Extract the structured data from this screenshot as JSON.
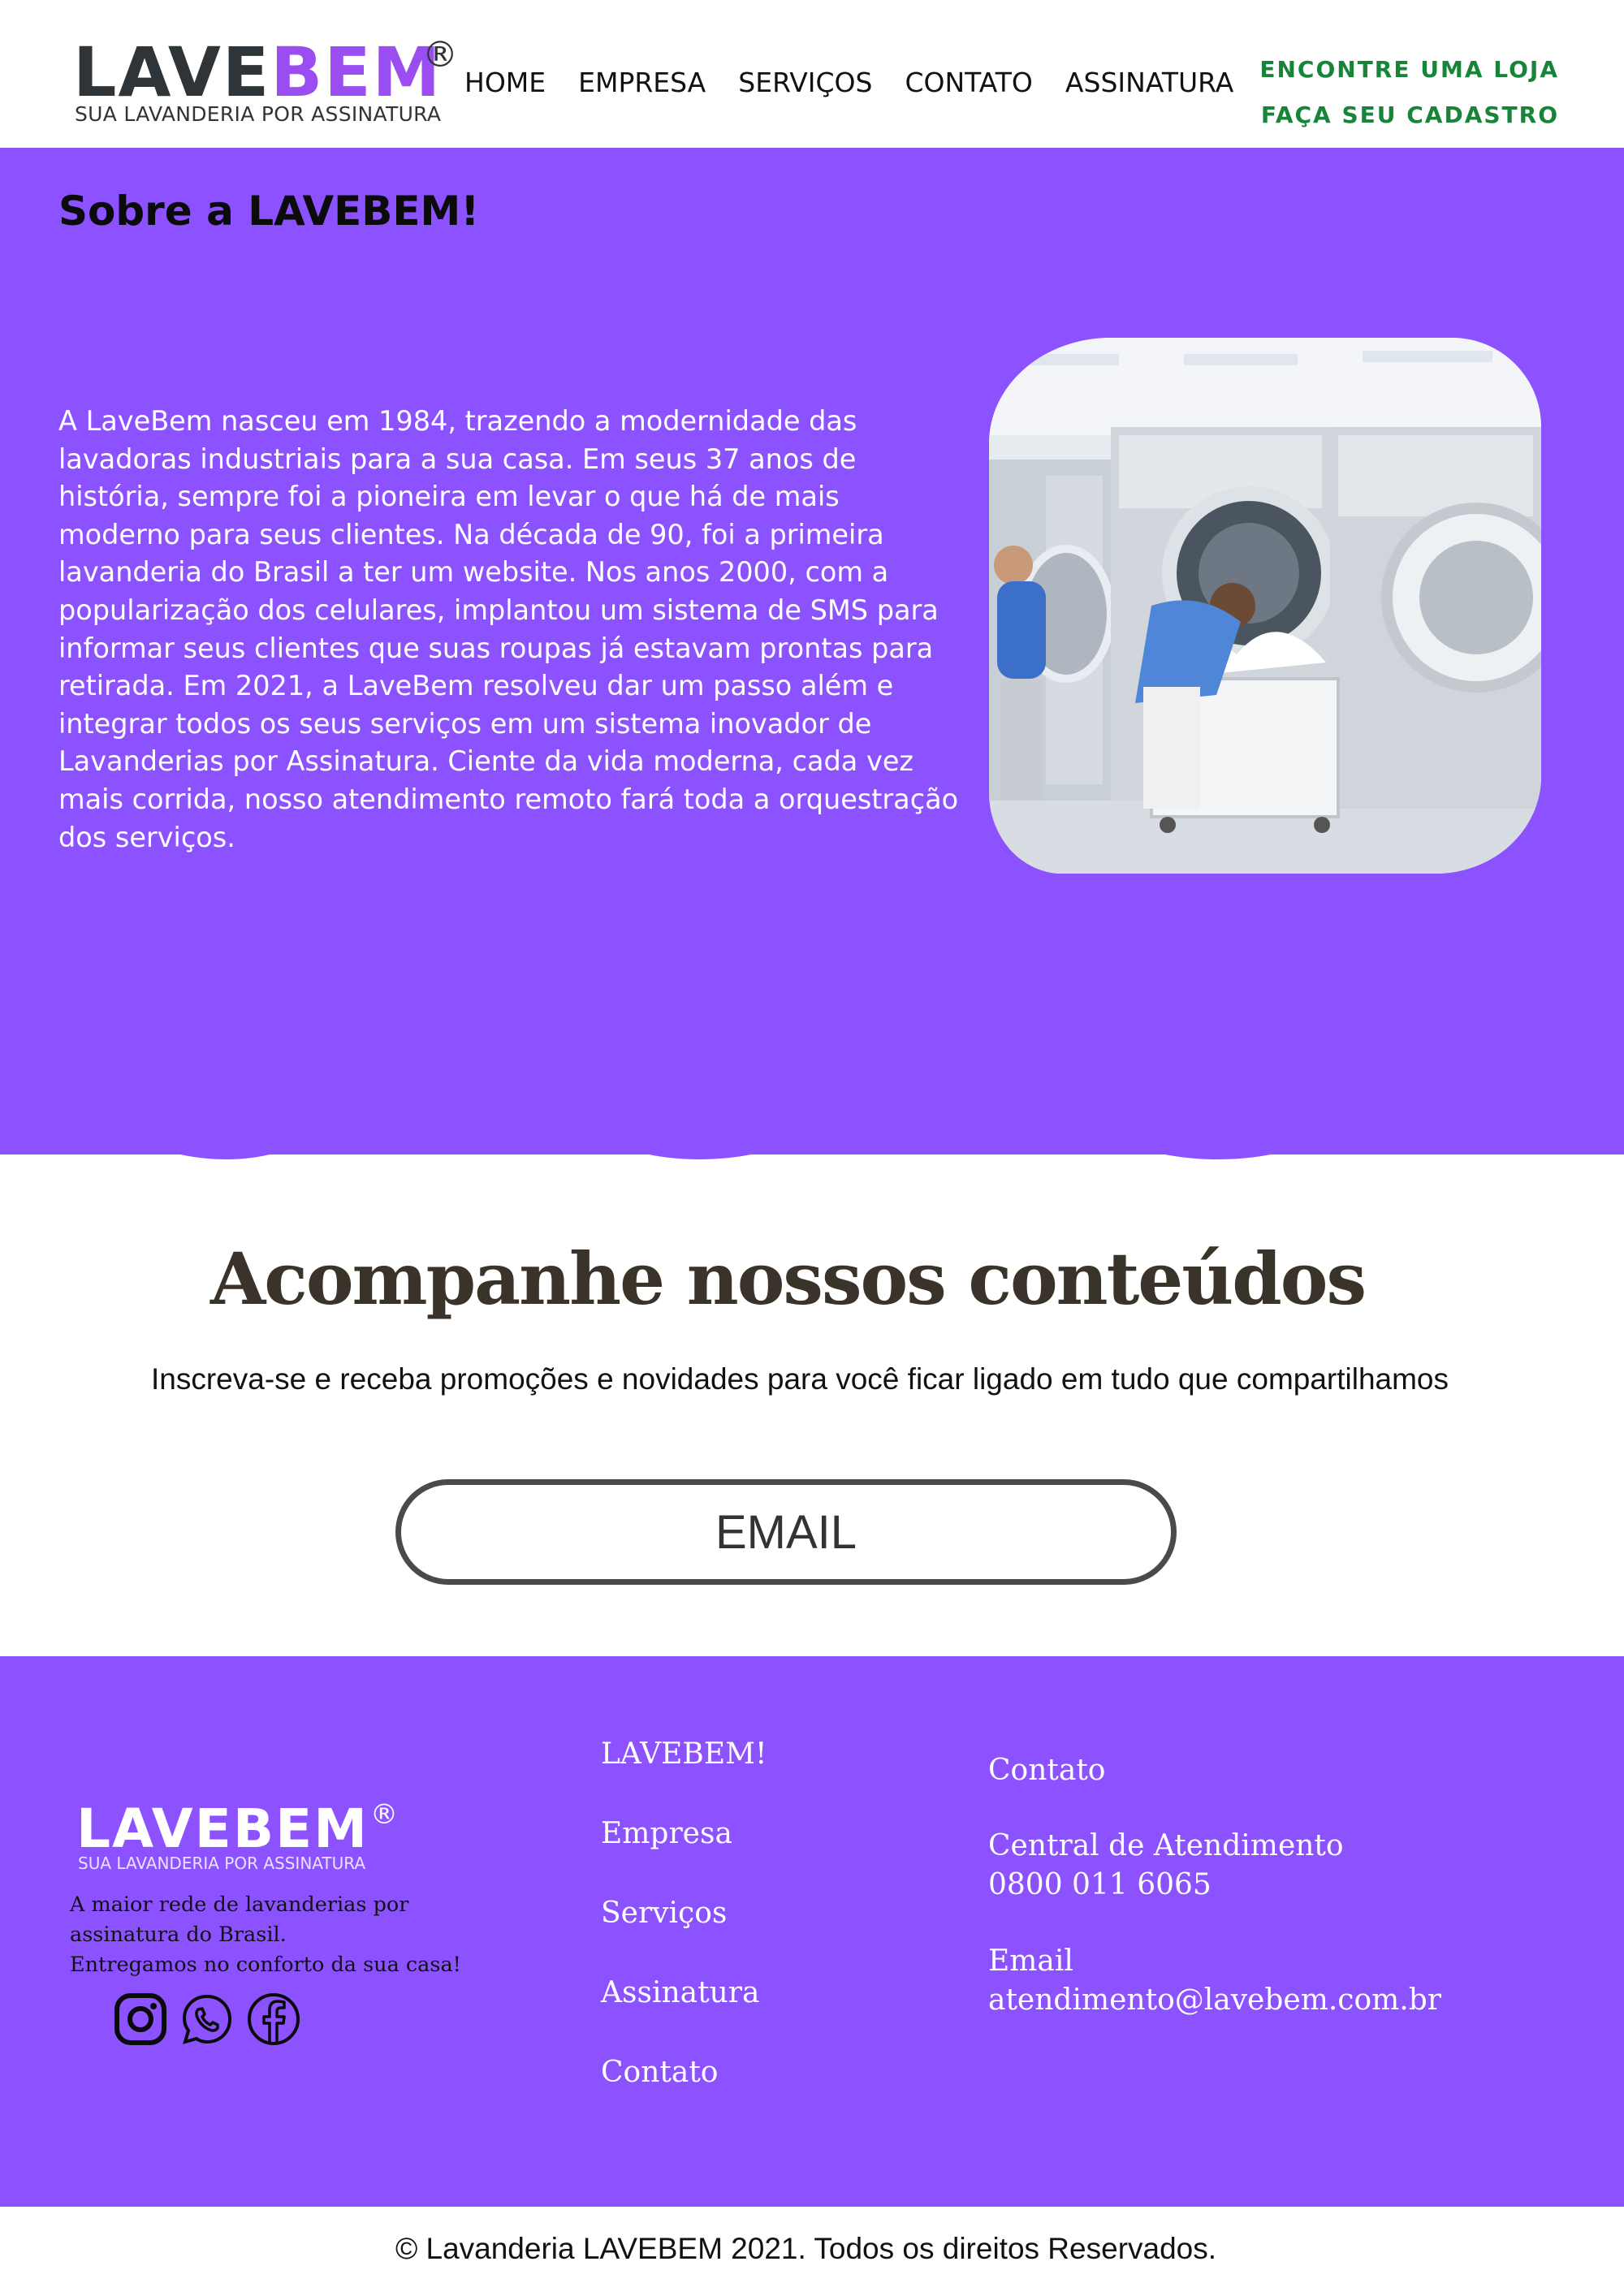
{
  "brand": {
    "name_part1": "LAVE",
    "name_part2": "BEM",
    "registered": "®",
    "tagline": "SUA LAVANDERIA POR ASSINATURA",
    "accent_color": "#8c52ff",
    "logo_purple": "#9a4df0",
    "cta_green": "#17843a"
  },
  "nav": {
    "items": [
      {
        "label": "HOME"
      },
      {
        "label": "EMPRESA"
      },
      {
        "label": "SERVIÇOS"
      },
      {
        "label": "CONTATO"
      },
      {
        "label": "ASSINATURA"
      }
    ]
  },
  "header_links": {
    "find_store": "ENCONTRE UMA LOJA",
    "register": "FAÇA SEU CADASTRO"
  },
  "about": {
    "title": "Sobre a LAVEBEM!",
    "text": "A LaveBem nasceu em 1984, trazendo a modernidade das lavadoras industriais para a sua casa. Em seus 37 anos de história, sempre foi a pioneira em levar o que há de mais moderno para seus clientes. Na década de 90, foi a primeira lavanderia do Brasil a ter um website. Nos anos 2000, com a popularização dos celulares, implantou um sistema de SMS para informar seus clientes que suas roupas já estavam prontas para retirada. Em 2021, a LaveBem resolveu dar um passo além e integrar todos os seus serviços em um sistema inovador de Lavanderias por Assinatura. Ciente da vida moderna, cada vez mais corrida, nosso atendimento remoto fará toda a orquestração dos serviços."
  },
  "newsletter": {
    "title": "Acompanhe nossos conteúdos",
    "subtitle": "Inscreva-se e receba promoções e novidades para você ficar ligado em tudo que compartilhamos",
    "email_placeholder": "EMAIL"
  },
  "footer": {
    "logo_name": "LAVEBEM",
    "logo_registered": "®",
    "logo_tagline": "SUA LAVANDERIA POR ASSINATURA",
    "description_lines": [
      "A maior rede de lavanderias por",
      "assinatura do Brasil.",
      "Entregamos no conforto da sua casa!"
    ],
    "social_icons": [
      "instagram-icon",
      "whatsapp-icon",
      "facebook-icon"
    ],
    "links": [
      {
        "label": "LAVEBEM!"
      },
      {
        "label": "Empresa"
      },
      {
        "label": "Serviços"
      },
      {
        "label": "Assinatura"
      },
      {
        "label": "Contato"
      }
    ],
    "contact": {
      "heading": "Contato",
      "support_label": "Central de Atendimento",
      "support_phone": "0800 011 6065",
      "email_label": "Email",
      "email_value": "atendimento@lavebem.com.br"
    }
  },
  "copyright": "© Lavanderia LAVEBEM 2021. Todos os direitos Reservados."
}
